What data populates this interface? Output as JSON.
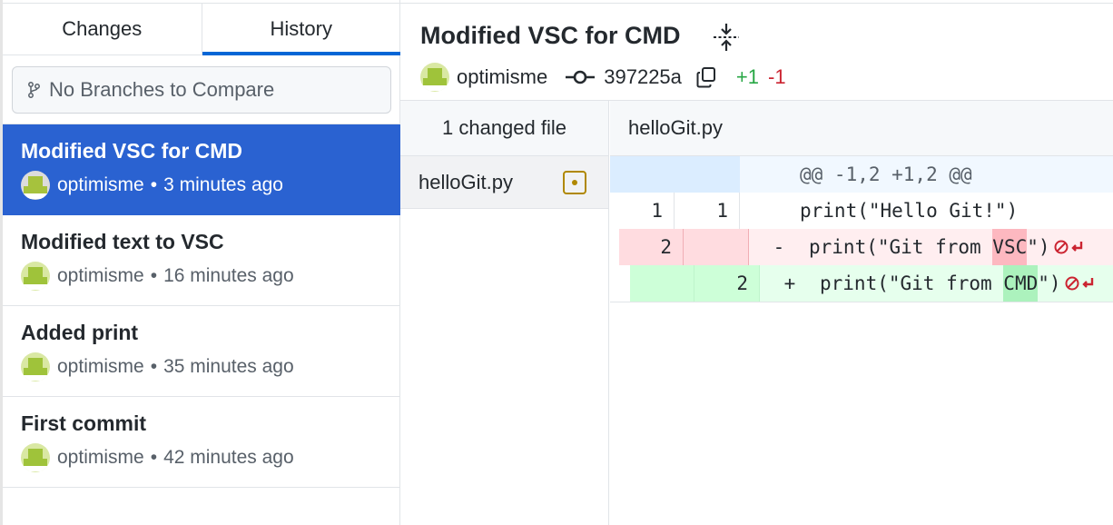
{
  "tabs": [
    {
      "label": "Changes",
      "active": false
    },
    {
      "label": "History",
      "active": true
    }
  ],
  "branch_compare": {
    "placeholder": "No Branches to Compare",
    "icon": "git-branch-icon"
  },
  "commits": [
    {
      "title": "Modified VSC for CMD",
      "author": "optimisme",
      "time": "3 minutes ago",
      "selected": true
    },
    {
      "title": "Modified text to VSC",
      "author": "optimisme",
      "time": "16 minutes ago",
      "selected": false
    },
    {
      "title": "Added print",
      "author": "optimisme",
      "time": "35 minutes ago",
      "selected": false
    },
    {
      "title": "First commit",
      "author": "optimisme",
      "time": "42 minutes ago",
      "selected": false
    }
  ],
  "meta_separator": "•",
  "detail": {
    "summary": "Modified VSC for CMD",
    "author": "optimisme",
    "sha": "397225a",
    "additions": "+1",
    "deletions": "-1"
  },
  "files_pane": {
    "header": "1 changed file",
    "files": [
      {
        "name": "helloGit.py",
        "status": "modified"
      }
    ]
  },
  "diff": {
    "filename": "helloGit.py",
    "hunk_header": "@@ -1,2 +1,2 @@",
    "lines": [
      {
        "type": "context",
        "old": "1",
        "new": "1",
        "marker": "",
        "before": "print(\"Hello Git!\")",
        "highlight": "",
        "after": ""
      },
      {
        "type": "del",
        "old": "2",
        "new": "",
        "marker": "-",
        "before": "print(\"Git from ",
        "highlight": "VSC",
        "after": "\")"
      },
      {
        "type": "add",
        "old": "",
        "new": "2",
        "marker": "+",
        "before": "print(\"Git from ",
        "highlight": "CMD",
        "after": "\")"
      }
    ]
  },
  "colors": {
    "accent": "#2a62d1",
    "tab_underline": "#0366d6",
    "addition": "#28a745",
    "deletion": "#cb2431",
    "modified": "#b08800"
  }
}
